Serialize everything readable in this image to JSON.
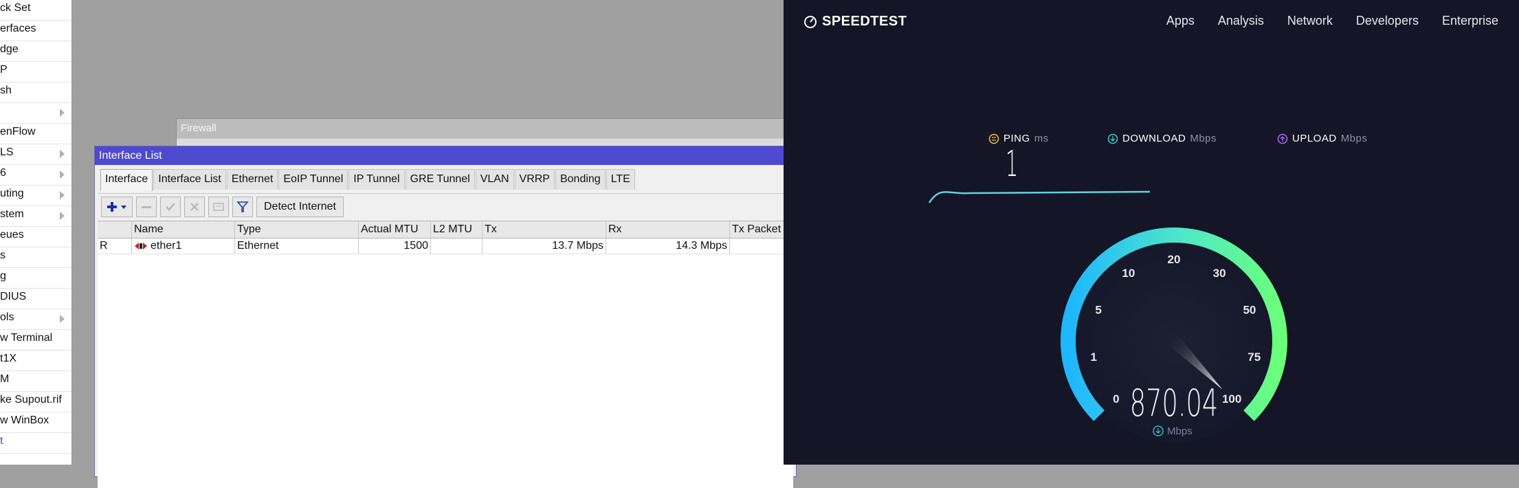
{
  "sidebar": {
    "items": [
      {
        "label": "ck Set",
        "arrow": false
      },
      {
        "label": "erfaces",
        "arrow": false
      },
      {
        "label": "dge",
        "arrow": false
      },
      {
        "label": "P",
        "arrow": false
      },
      {
        "label": "sh",
        "arrow": false
      },
      {
        "label": "",
        "arrow": true
      },
      {
        "label": "enFlow",
        "arrow": false
      },
      {
        "label": "LS",
        "arrow": true
      },
      {
        "label": "6",
        "arrow": true
      },
      {
        "label": "uting",
        "arrow": true
      },
      {
        "label": "stem",
        "arrow": true
      },
      {
        "label": "eues",
        "arrow": false
      },
      {
        "label": "s",
        "arrow": false
      },
      {
        "label": "g",
        "arrow": false
      },
      {
        "label": "DIUS",
        "arrow": false
      },
      {
        "label": "ols",
        "arrow": true
      },
      {
        "label": "w Terminal",
        "arrow": false
      },
      {
        "label": "t1X",
        "arrow": false
      },
      {
        "label": "M",
        "arrow": false
      },
      {
        "label": "ke Supout.rif",
        "arrow": false
      },
      {
        "label": "w WinBox",
        "arrow": false
      },
      {
        "label": "t",
        "arrow": false
      }
    ]
  },
  "firewall": {
    "title": "Firewall"
  },
  "interface_list": {
    "title": "Interface List",
    "tabs": [
      "Interface",
      "Interface List",
      "Ethernet",
      "EoIP Tunnel",
      "IP Tunnel",
      "GRE Tunnel",
      "VLAN",
      "VRRP",
      "Bonding",
      "LTE"
    ],
    "active_tab": "Interface",
    "toolbar": {
      "detect_label": "Detect Internet"
    },
    "columns": [
      "",
      "Name",
      "Type",
      "Actual MTU",
      "L2 MTU",
      "Tx",
      "Rx",
      "Tx Packet"
    ],
    "rows": [
      {
        "flag": "R",
        "name": "ether1",
        "type": "Ethernet",
        "actual_mtu": "1500",
        "l2_mtu": "",
        "tx": "13.7 Mbps",
        "rx": "14.3 Mbps",
        "tx_packet": ""
      }
    ]
  },
  "speedtest": {
    "logo": "SPEEDTEST",
    "nav": [
      "Apps",
      "Analysis",
      "Network",
      "Developers",
      "Enterprise"
    ],
    "ping": {
      "label": "PING",
      "unit": "ms",
      "value": "1"
    },
    "download": {
      "label": "DOWNLOAD",
      "unit": "Mbps"
    },
    "upload": {
      "label": "UPLOAD",
      "unit": "Mbps"
    },
    "gauge": {
      "ticks": [
        "0",
        "1",
        "5",
        "10",
        "20",
        "30",
        "50",
        "75",
        "100"
      ],
      "value": "870.04",
      "unit": "Mbps",
      "fraction": 1.0
    },
    "colors": {
      "bg": "#141526",
      "gauge_start": "#1fb6ff",
      "gauge_end": "#6bff7a",
      "ping_icon": "#f5c542",
      "download_icon": "#3fd0d8",
      "upload_icon": "#b46cf5"
    }
  }
}
